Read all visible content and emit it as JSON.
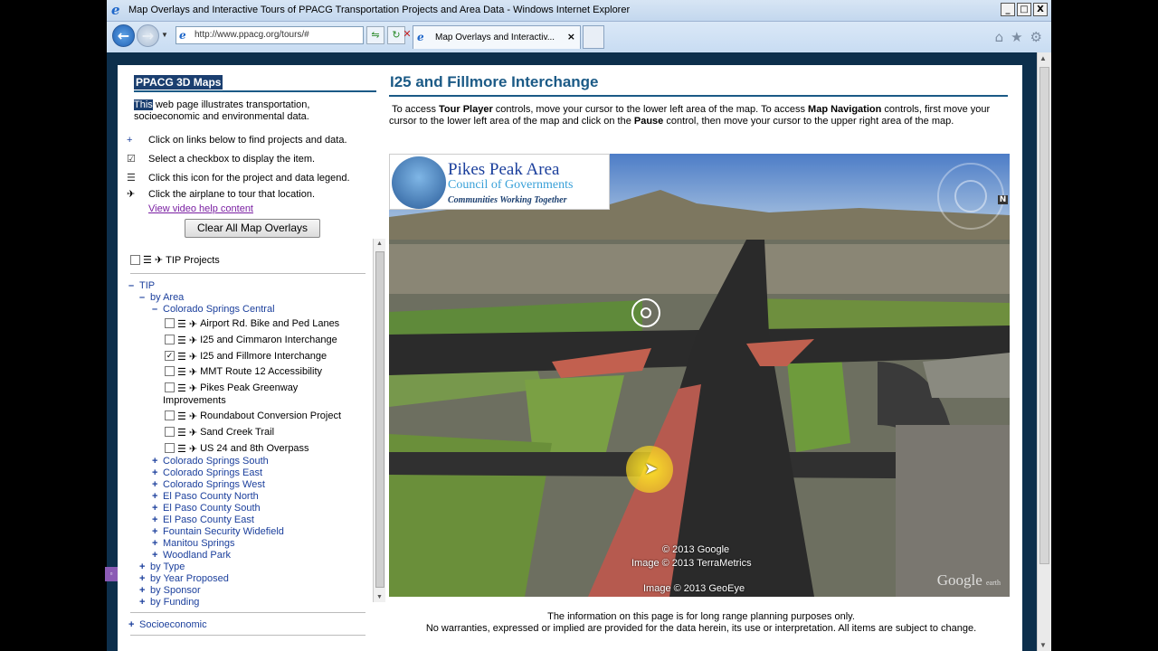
{
  "window": {
    "title": "Map Overlays and Interactive Tours of PPACG Transportation Projects and Area Data - Windows Internet Explorer",
    "ie_icon": "ie-logo-icon",
    "buttons": {
      "minimize": "_",
      "maximize": "□",
      "close": "X"
    }
  },
  "browser": {
    "url": "http://www.ppacg.org/tours/#",
    "tab_label": "Map Overlays and Interactiv...",
    "tab_close": "×"
  },
  "sidebar": {
    "title": "PPACG 3D Maps",
    "intro_highlight": "This",
    "intro_rest": " web page illustrates transportation, socioeconomic and environmental data.",
    "help": [
      {
        "icon": "+",
        "text": "Click on links below to find projects and data."
      },
      {
        "icon": "☑",
        "text": "Select a checkbox to display the item."
      },
      {
        "icon": "☰",
        "text": "Click this icon for the project and data legend."
      },
      {
        "icon": "✈",
        "text": "Click the airplane to tour that location."
      }
    ],
    "video_link": "View video help content",
    "clear_button": "Clear All Map Overlays",
    "tip_projects": "TIP Projects",
    "tree": {
      "tip": "TIP",
      "by_area": "by Area",
      "cs_central": "Colorado Springs Central",
      "projects": [
        {
          "label": "Airport Rd. Bike and Ped Lanes",
          "checked": false
        },
        {
          "label": "I25 and Cimmaron Interchange",
          "checked": false
        },
        {
          "label": "I25 and Fillmore Interchange",
          "checked": true
        },
        {
          "label": "MMT Route 12 Accessibility",
          "checked": false
        },
        {
          "label": "Pikes Peak Greenway",
          "label2": "Improvements",
          "checked": false
        },
        {
          "label": "Roundabout Conversion Project",
          "checked": false
        },
        {
          "label": "Sand Creek Trail",
          "checked": false
        },
        {
          "label": "US 24 and 8th Overpass",
          "checked": false
        }
      ],
      "areas": [
        "Colorado Springs South",
        "Colorado Springs East",
        "Colorado Springs West",
        "El Paso County North",
        "El Paso County South",
        "El Paso County East",
        "Fountain Security Widefield",
        "Manitou Springs",
        "Woodland Park"
      ],
      "groups": [
        "by Type",
        "by Year Proposed",
        "by Sponsor",
        "by Funding"
      ],
      "socioeconomic": "Socioeconomic"
    }
  },
  "main": {
    "title": "I25 and Fillmore Interchange",
    "instr_1": "To access ",
    "instr_b1": "Tour Player",
    "instr_2": " controls, move your cursor to the lower left area of the map. To access ",
    "instr_b2": "Map Navigation",
    "instr_3": " controls, first move your cursor to the lower left area of the map and click on the ",
    "instr_b3": "Pause",
    "instr_4": " control, then move your cursor to the upper right area of the map.",
    "map": {
      "logo_name": "Pikes Peak Area",
      "logo_sub": "Council of Governments",
      "logo_tag": "Communities Working Together",
      "copyright_1": "© 2013 Google",
      "copyright_2": "Image © 2013 TerraMetrics",
      "copyright_3": "Image © 2013 GeoEye",
      "google_earth": "Google",
      "google_earth_suffix": "earth"
    },
    "disclaimer_1": "The information on this page is for long range planning purposes only.",
    "disclaimer_2": "No warranties, expressed or implied are provided for the data herein, its use or interpretation. All items are subject to change."
  }
}
